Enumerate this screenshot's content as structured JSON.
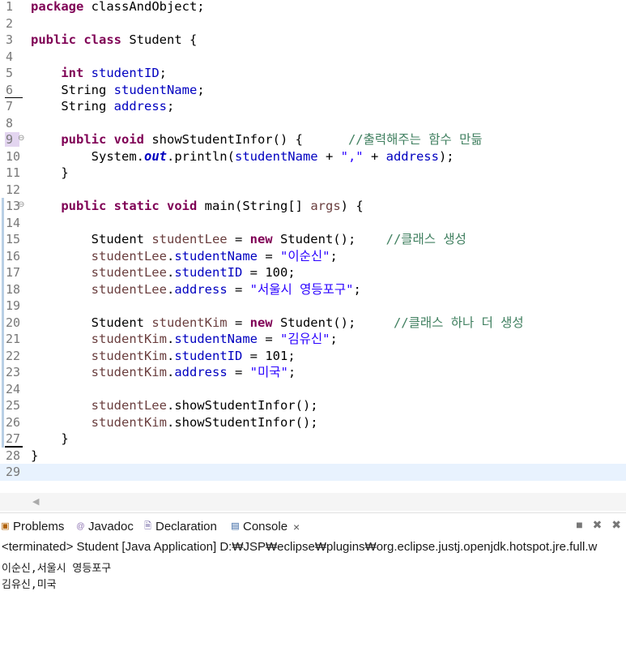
{
  "editor": {
    "current_line": 29,
    "lines": [
      {
        "num": "1",
        "segments": [
          {
            "t": "package",
            "c": "kw"
          },
          {
            "t": " classAndObject;",
            "c": ""
          }
        ]
      },
      {
        "num": "2",
        "segments": []
      },
      {
        "num": "3",
        "segments": [
          {
            "t": "public",
            "c": "kw"
          },
          {
            "t": " ",
            "c": ""
          },
          {
            "t": "class",
            "c": "kw"
          },
          {
            "t": " Student {",
            "c": ""
          }
        ]
      },
      {
        "num": "4",
        "segments": []
      },
      {
        "num": "5",
        "segments": [
          {
            "t": "    ",
            "c": ""
          },
          {
            "t": "int",
            "c": "kw"
          },
          {
            "t": " ",
            "c": ""
          },
          {
            "t": "studentID",
            "c": "fld"
          },
          {
            "t": ";",
            "c": ""
          }
        ]
      },
      {
        "num": "6",
        "segments": [
          {
            "t": "    String ",
            "c": ""
          },
          {
            "t": "studentName",
            "c": "fld"
          },
          {
            "t": ";",
            "c": ""
          }
        ]
      },
      {
        "num": "7",
        "segments": [
          {
            "t": "    String ",
            "c": ""
          },
          {
            "t": "address",
            "c": "fld"
          },
          {
            "t": ";",
            "c": ""
          }
        ]
      },
      {
        "num": "8",
        "segments": []
      },
      {
        "num": "9",
        "fold": true,
        "segments": [
          {
            "t": "    ",
            "c": ""
          },
          {
            "t": "public",
            "c": "kw"
          },
          {
            "t": " ",
            "c": ""
          },
          {
            "t": "void",
            "c": "kw"
          },
          {
            "t": " showStudentInfor() {      ",
            "c": ""
          },
          {
            "t": "//출력해주는 함수 만듦",
            "c": "cmt"
          }
        ]
      },
      {
        "num": "10",
        "segments": [
          {
            "t": "        System.",
            "c": ""
          },
          {
            "t": "out",
            "c": "sfld"
          },
          {
            "t": ".println(",
            "c": ""
          },
          {
            "t": "studentName",
            "c": "fld"
          },
          {
            "t": " + ",
            "c": ""
          },
          {
            "t": "\",\"",
            "c": "str"
          },
          {
            "t": " + ",
            "c": ""
          },
          {
            "t": "address",
            "c": "fld"
          },
          {
            "t": ");",
            "c": ""
          }
        ]
      },
      {
        "num": "11",
        "segments": [
          {
            "t": "    }",
            "c": ""
          }
        ]
      },
      {
        "num": "12",
        "segments": []
      },
      {
        "num": "13",
        "fold": true,
        "segments": [
          {
            "t": "    ",
            "c": ""
          },
          {
            "t": "public",
            "c": "kw"
          },
          {
            "t": " ",
            "c": ""
          },
          {
            "t": "static",
            "c": "kw"
          },
          {
            "t": " ",
            "c": ""
          },
          {
            "t": "void",
            "c": "kw"
          },
          {
            "t": " main(String[] ",
            "c": ""
          },
          {
            "t": "args",
            "c": "lvar"
          },
          {
            "t": ") {",
            "c": ""
          }
        ]
      },
      {
        "num": "14",
        "segments": []
      },
      {
        "num": "15",
        "segments": [
          {
            "t": "        Student ",
            "c": ""
          },
          {
            "t": "studentLee",
            "c": "lvar"
          },
          {
            "t": " = ",
            "c": ""
          },
          {
            "t": "new",
            "c": "kw"
          },
          {
            "t": " Student();    ",
            "c": ""
          },
          {
            "t": "//클래스 생성",
            "c": "cmt"
          }
        ]
      },
      {
        "num": "16",
        "segments": [
          {
            "t": "        ",
            "c": ""
          },
          {
            "t": "studentLee",
            "c": "lvar"
          },
          {
            "t": ".",
            "c": ""
          },
          {
            "t": "studentName",
            "c": "fld"
          },
          {
            "t": " = ",
            "c": ""
          },
          {
            "t": "\"이순신\"",
            "c": "str"
          },
          {
            "t": ";",
            "c": ""
          }
        ]
      },
      {
        "num": "17",
        "segments": [
          {
            "t": "        ",
            "c": ""
          },
          {
            "t": "studentLee",
            "c": "lvar"
          },
          {
            "t": ".",
            "c": ""
          },
          {
            "t": "studentID",
            "c": "fld"
          },
          {
            "t": " = 100;",
            "c": ""
          }
        ]
      },
      {
        "num": "18",
        "segments": [
          {
            "t": "        ",
            "c": ""
          },
          {
            "t": "studentLee",
            "c": "lvar"
          },
          {
            "t": ".",
            "c": ""
          },
          {
            "t": "address",
            "c": "fld"
          },
          {
            "t": " = ",
            "c": ""
          },
          {
            "t": "\"서울시 영등포구\"",
            "c": "str"
          },
          {
            "t": ";",
            "c": ""
          }
        ]
      },
      {
        "num": "19",
        "segments": []
      },
      {
        "num": "20",
        "segments": [
          {
            "t": "        Student ",
            "c": ""
          },
          {
            "t": "studentKim",
            "c": "lvar"
          },
          {
            "t": " = ",
            "c": ""
          },
          {
            "t": "new",
            "c": "kw"
          },
          {
            "t": " Student();     ",
            "c": ""
          },
          {
            "t": "//클래스 하나 더 생성",
            "c": "cmt"
          }
        ]
      },
      {
        "num": "21",
        "segments": [
          {
            "t": "        ",
            "c": ""
          },
          {
            "t": "studentKim",
            "c": "lvar"
          },
          {
            "t": ".",
            "c": ""
          },
          {
            "t": "studentName",
            "c": "fld"
          },
          {
            "t": " = ",
            "c": ""
          },
          {
            "t": "\"김유신\"",
            "c": "str"
          },
          {
            "t": ";",
            "c": ""
          }
        ]
      },
      {
        "num": "22",
        "segments": [
          {
            "t": "        ",
            "c": ""
          },
          {
            "t": "studentKim",
            "c": "lvar"
          },
          {
            "t": ".",
            "c": ""
          },
          {
            "t": "studentID",
            "c": "fld"
          },
          {
            "t": " = 101;",
            "c": ""
          }
        ]
      },
      {
        "num": "23",
        "segments": [
          {
            "t": "        ",
            "c": ""
          },
          {
            "t": "studentKim",
            "c": "lvar"
          },
          {
            "t": ".",
            "c": ""
          },
          {
            "t": "address",
            "c": "fld"
          },
          {
            "t": " = ",
            "c": ""
          },
          {
            "t": "\"미국\"",
            "c": "str"
          },
          {
            "t": ";",
            "c": ""
          }
        ]
      },
      {
        "num": "24",
        "segments": []
      },
      {
        "num": "25",
        "segments": [
          {
            "t": "        ",
            "c": ""
          },
          {
            "t": "studentLee",
            "c": "lvar"
          },
          {
            "t": ".showStudentInfor();",
            "c": ""
          }
        ]
      },
      {
        "num": "26",
        "segments": [
          {
            "t": "        ",
            "c": ""
          },
          {
            "t": "studentKim",
            "c": "lvar"
          },
          {
            "t": ".showStudentInfor();",
            "c": ""
          }
        ]
      },
      {
        "num": "27",
        "segments": [
          {
            "t": "    }",
            "c": ""
          }
        ]
      },
      {
        "num": "28",
        "segments": [
          {
            "t": "}",
            "c": ""
          }
        ]
      },
      {
        "num": "29",
        "segments": []
      }
    ]
  },
  "panel": {
    "tabs": [
      {
        "label": "Problems",
        "icon": "problems-icon",
        "glyph": "▣"
      },
      {
        "label": "Javadoc",
        "icon": "javadoc-icon",
        "glyph": "@"
      },
      {
        "label": "Declaration",
        "icon": "declaration-icon",
        "glyph": "🗎"
      },
      {
        "label": "Console",
        "icon": "console-icon",
        "glyph": "▤",
        "active": true
      }
    ],
    "close_glyph": "×",
    "tools_glyph": "■ ✖ ✖",
    "terminated_line": "<terminated> Student [Java Application] D:₩JSP₩eclipse₩plugins₩org.eclipse.justj.openjdk.hotspot.jre.full.w",
    "output": [
      "이순신,서울시 영등포구",
      "김유신,미국"
    ]
  },
  "colors": {
    "keyword": "#7f0055",
    "field": "#0000c0",
    "string": "#2a00ff",
    "comment": "#3f7f5f",
    "current_line": "#e8f2fe"
  }
}
